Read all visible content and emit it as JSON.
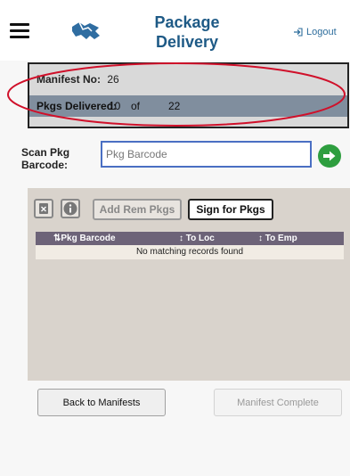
{
  "header": {
    "title_line1": "Package",
    "title_line2": "Delivery",
    "logout_label": "Logout"
  },
  "manifest": {
    "manifest_label": "Manifest No:",
    "manifest_no": "26",
    "delivered_label": "Pkgs Delivered:",
    "delivered_count": "10",
    "of_label": "of",
    "total_count": "22"
  },
  "scan": {
    "label_line1": "Scan Pkg",
    "label_line2": "Barcode:",
    "placeholder": "Pkg Barcode",
    "value": ""
  },
  "toolbar": {
    "add_rem_label": "Add Rem Pkgs",
    "sign_label": "Sign for Pkgs"
  },
  "table": {
    "columns": [
      "Pkg Barcode",
      "To Loc",
      "To Emp"
    ],
    "empty_message": "No matching records found"
  },
  "footer": {
    "back_label": "Back to Manifests",
    "complete_label": "Manifest Complete"
  },
  "colors": {
    "title": "#1e5a86",
    "accent_go": "#2e9e3f",
    "table_header": "#6d6378",
    "annotation": "#d0102a"
  },
  "icons": [
    "menu-icon",
    "handshake-icon",
    "logout-icon",
    "arrow-right-icon",
    "clear-icon",
    "info-icon",
    "sort-icon"
  ]
}
